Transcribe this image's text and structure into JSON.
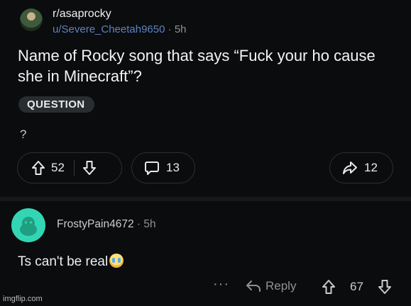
{
  "post": {
    "subreddit": "r/asaprocky",
    "username": "u/Severe_Cheetah9650",
    "separator": "·",
    "age": "5h",
    "title": "Name of Rocky song that says “Fuck your ho cause she in Minecraft”?",
    "flair": "QUESTION",
    "body": "?",
    "upvotes": "52",
    "comments": "13",
    "shares": "12"
  },
  "comment": {
    "username": "FrostyPain4672",
    "separator": "·",
    "age": "5h",
    "text": "Ts can't be real",
    "emoji": "crying-laughing-emoji",
    "more_label": "···",
    "reply_label": "Reply",
    "score": "67"
  },
  "watermark": "imgflip.com",
  "colors": {
    "background": "#0b0c0d",
    "username_link": "#5a84c4",
    "avatar": "#33d6b4"
  }
}
